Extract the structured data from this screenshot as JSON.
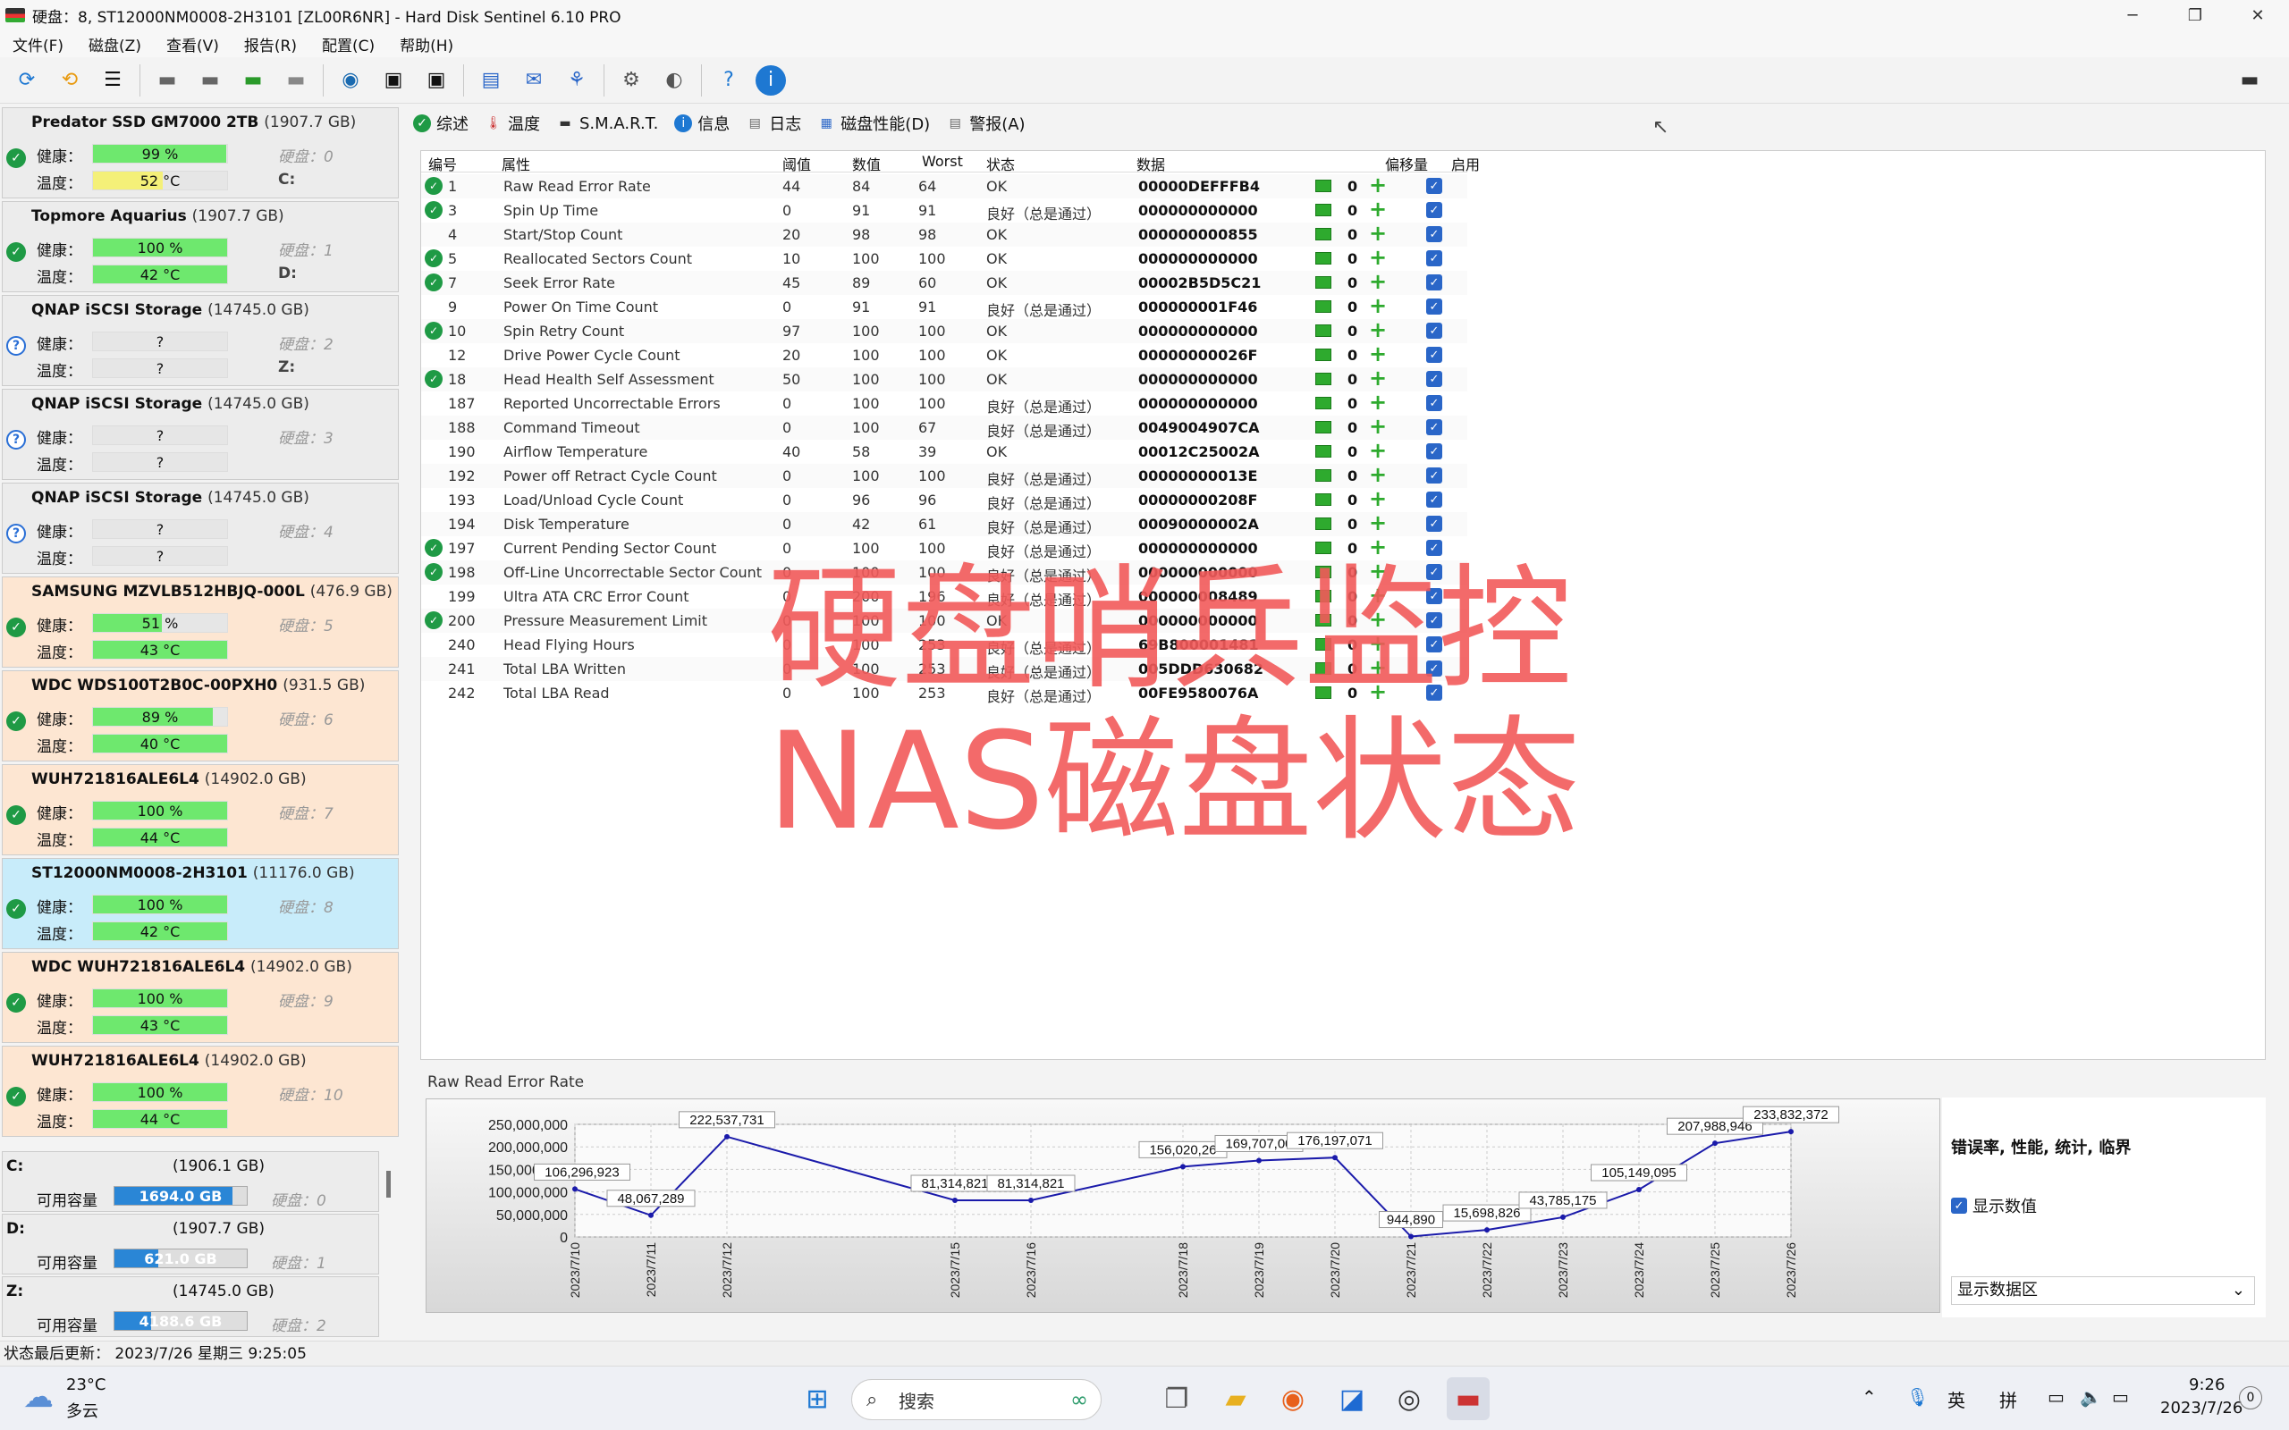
{
  "window": {
    "title": "硬盘：8, ST12000NM0008-2H3101 [ZL00R6NR]  -  Hard Disk Sentinel 6.10 PRO"
  },
  "menu": [
    "文件(F)",
    "磁盘(Z)",
    "查看(V)",
    "报告(R)",
    "配置(C)",
    "帮助(H)"
  ],
  "disks": [
    {
      "name": "Predator SSD GM7000 2TB",
      "cap": "(1907.7 GB)",
      "health": "99 %",
      "health_pct": 99,
      "temp": "52 °C",
      "temp_pct": 52,
      "temp_warn": true,
      "disk": "硬盘：0",
      "letter": "C:",
      "status": "ok",
      "style": "plain"
    },
    {
      "name": "Topmore Aquarius",
      "cap": "(1907.7 GB)",
      "health": "100 %",
      "health_pct": 100,
      "temp": "42 °C",
      "temp_pct": 100,
      "disk": "硬盘：1",
      "letter": "D:",
      "status": "ok",
      "style": "plain"
    },
    {
      "name": "QNAP     iSCSI Storage",
      "cap": "(14745.0 GB)",
      "health": "?",
      "health_pct": 0,
      "temp": "?",
      "temp_pct": 0,
      "disk": "硬盘：2",
      "letter": "Z:",
      "status": "q",
      "style": "plain"
    },
    {
      "name": "QNAP     iSCSI Storage",
      "cap": "(14745.0 GB)",
      "health": "?",
      "health_pct": 0,
      "temp": "?",
      "temp_pct": 0,
      "disk": "硬盘：3",
      "letter": "",
      "status": "q",
      "style": "plain"
    },
    {
      "name": "QNAP     iSCSI Storage",
      "cap": "(14745.0 GB)",
      "health": "?",
      "health_pct": 0,
      "temp": "?",
      "temp_pct": 0,
      "disk": "硬盘：4",
      "letter": "",
      "status": "q",
      "style": "plain"
    },
    {
      "name": "SAMSUNG MZVLB512HBJQ-000L",
      "cap": "(476.9 GB)",
      "health": "51 %",
      "health_pct": 51,
      "temp": "43 °C",
      "temp_pct": 100,
      "disk": "硬盘：5",
      "letter": "",
      "status": "ok",
      "style": "warm"
    },
    {
      "name": "WDC WDS100T2B0C-00PXH0",
      "cap": "(931.5 GB)",
      "health": "89 %",
      "health_pct": 89,
      "temp": "40 °C",
      "temp_pct": 100,
      "disk": "硬盘：6",
      "letter": "",
      "status": "ok",
      "style": "warm"
    },
    {
      "name": "WUH721816ALE6L4",
      "cap": "(14902.0 GB)",
      "health": "100 %",
      "health_pct": 100,
      "temp": "44 °C",
      "temp_pct": 100,
      "disk": "硬盘：7",
      "letter": "",
      "status": "ok",
      "style": "warm"
    },
    {
      "name": "ST12000NM0008-2H3101",
      "cap": "(11176.0 GB)",
      "health": "100 %",
      "health_pct": 100,
      "temp": "42 °C",
      "temp_pct": 100,
      "disk": "硬盘：8",
      "letter": "",
      "status": "ok",
      "style": "sel"
    },
    {
      "name": "WDC  WUH721816ALE6L4",
      "cap": "(14902.0 GB)",
      "health": "100 %",
      "health_pct": 100,
      "temp": "43 °C",
      "temp_pct": 100,
      "disk": "硬盘：9",
      "letter": "",
      "status": "ok",
      "style": "warm"
    },
    {
      "name": "WUH721816ALE6L4",
      "cap": "(14902.0 GB)",
      "health": "100 %",
      "health_pct": 100,
      "temp": "44 °C",
      "temp_pct": 100,
      "disk": "硬盘：10",
      "letter": "",
      "status": "ok",
      "style": "warm"
    }
  ],
  "labels": {
    "health": "健康：",
    "temp": "温度：",
    "free": "可用容量"
  },
  "volumes": [
    {
      "letter": "C:",
      "cap": "(1906.1 GB)",
      "free": "1694.0 GB",
      "free_pct": 89,
      "disk": "硬盘：0"
    },
    {
      "letter": "D:",
      "cap": "(1907.7 GB)",
      "free": "621.0 GB",
      "free_pct": 33,
      "disk": "硬盘：1"
    },
    {
      "letter": "Z:",
      "cap": "(14745.0 GB)",
      "free": "4188.6 GB",
      "free_pct": 28,
      "disk": "硬盘：2"
    }
  ],
  "status_bar": "状态最后更新：  2023/7/26 星期三 9:25:05",
  "tabs": [
    "综述",
    "温度",
    "S.M.A.R.T.",
    "信息",
    "日志",
    "磁盘性能(D)",
    "警报(A)"
  ],
  "table": {
    "headers": [
      "编号",
      "属性",
      "阈值",
      "数值",
      "Worst",
      "状态",
      "数据",
      "偏移量",
      "启用"
    ],
    "rows": [
      {
        "ok": true,
        "id": "1",
        "attr": "Raw Read Error Rate",
        "thr": "44",
        "val": "84",
        "worst": "64",
        "st": "OK",
        "data": "00000DEFFFB4",
        "off": "0"
      },
      {
        "ok": true,
        "id": "3",
        "attr": "Spin Up Time",
        "thr": "0",
        "val": "91",
        "worst": "91",
        "st": "良好（总是通过）",
        "data": "000000000000",
        "off": "0"
      },
      {
        "ok": false,
        "id": "4",
        "attr": "Start/Stop Count",
        "thr": "20",
        "val": "98",
        "worst": "98",
        "st": "OK",
        "data": "000000000855",
        "off": "0"
      },
      {
        "ok": true,
        "id": "5",
        "attr": "Reallocated Sectors Count",
        "thr": "10",
        "val": "100",
        "worst": "100",
        "st": "OK",
        "data": "000000000000",
        "off": "0"
      },
      {
        "ok": true,
        "id": "7",
        "attr": "Seek Error Rate",
        "thr": "45",
        "val": "89",
        "worst": "60",
        "st": "OK",
        "data": "00002B5D5C21",
        "off": "0"
      },
      {
        "ok": false,
        "id": "9",
        "attr": "Power On Time Count",
        "thr": "0",
        "val": "91",
        "worst": "91",
        "st": "良好（总是通过）",
        "data": "000000001F46",
        "off": "0"
      },
      {
        "ok": true,
        "id": "10",
        "attr": "Spin Retry Count",
        "thr": "97",
        "val": "100",
        "worst": "100",
        "st": "OK",
        "data": "000000000000",
        "off": "0"
      },
      {
        "ok": false,
        "id": "12",
        "attr": "Drive Power Cycle Count",
        "thr": "20",
        "val": "100",
        "worst": "100",
        "st": "OK",
        "data": "00000000026F",
        "off": "0"
      },
      {
        "ok": true,
        "id": "18",
        "attr": "Head Health Self Assessment",
        "thr": "50",
        "val": "100",
        "worst": "100",
        "st": "OK",
        "data": "000000000000",
        "off": "0"
      },
      {
        "ok": false,
        "id": "187",
        "attr": "Reported Uncorrectable Errors",
        "thr": "0",
        "val": "100",
        "worst": "100",
        "st": "良好（总是通过）",
        "data": "000000000000",
        "off": "0"
      },
      {
        "ok": false,
        "id": "188",
        "attr": "Command Timeout",
        "thr": "0",
        "val": "100",
        "worst": "67",
        "st": "良好（总是通过）",
        "data": "0049004907CA",
        "off": "0"
      },
      {
        "ok": false,
        "id": "190",
        "attr": "Airflow Temperature",
        "thr": "40",
        "val": "58",
        "worst": "39",
        "st": "OK",
        "data": "00012C25002A",
        "off": "0"
      },
      {
        "ok": false,
        "id": "192",
        "attr": "Power off Retract Cycle Count",
        "thr": "0",
        "val": "100",
        "worst": "100",
        "st": "良好（总是通过）",
        "data": "00000000013E",
        "off": "0"
      },
      {
        "ok": false,
        "id": "193",
        "attr": "Load/Unload Cycle Count",
        "thr": "0",
        "val": "96",
        "worst": "96",
        "st": "良好（总是通过）",
        "data": "00000000208F",
        "off": "0"
      },
      {
        "ok": false,
        "id": "194",
        "attr": "Disk Temperature",
        "thr": "0",
        "val": "42",
        "worst": "61",
        "st": "良好（总是通过）",
        "data": "00090000002A",
        "off": "0"
      },
      {
        "ok": true,
        "id": "197",
        "attr": "Current Pending Sector Count",
        "thr": "0",
        "val": "100",
        "worst": "100",
        "st": "良好（总是通过）",
        "data": "000000000000",
        "off": "0"
      },
      {
        "ok": true,
        "id": "198",
        "attr": "Off-Line Uncorrectable Sector Count",
        "thr": "0",
        "val": "100",
        "worst": "100",
        "st": "良好（总是通过）",
        "data": "000000000000",
        "off": "0"
      },
      {
        "ok": false,
        "id": "199",
        "attr": "Ultra ATA CRC Error Count",
        "thr": "0",
        "val": "200",
        "worst": "196",
        "st": "良好（总是通过）",
        "data": "000000008489",
        "off": "0"
      },
      {
        "ok": true,
        "id": "200",
        "attr": "Pressure Measurement Limit",
        "thr": "0",
        "val": "100",
        "worst": "100",
        "st": "OK",
        "data": "000000000000",
        "off": "0"
      },
      {
        "ok": false,
        "id": "240",
        "attr": "Head Flying Hours",
        "thr": "0",
        "val": "100",
        "worst": "253",
        "st": "良好（总是通过）",
        "data": "69B800001481",
        "off": "0"
      },
      {
        "ok": false,
        "id": "241",
        "attr": "Total LBA Written",
        "thr": "0",
        "val": "100",
        "worst": "253",
        "st": "良好（总是通过）",
        "data": "005DDD630682",
        "off": "0"
      },
      {
        "ok": false,
        "id": "242",
        "attr": "Total LBA Read",
        "thr": "0",
        "val": "100",
        "worst": "253",
        "st": "良好（总是通过）",
        "data": "00FE9580076A",
        "off": "0"
      }
    ]
  },
  "watermark": [
    "硬盘哨兵监控",
    "NAS磁盘状态"
  ],
  "graph_tab": "Raw Read Error Rate",
  "chart_data": {
    "type": "line",
    "x": [
      "2023/7/10",
      "2023/7/11",
      "2023/7/12",
      "2023/7/15",
      "2023/7/16",
      "2023/7/18",
      "2023/7/19",
      "2023/7/20",
      "2023/7/21",
      "2023/7/22",
      "2023/7/23",
      "2023/7/24",
      "2023/7/25",
      "2023/7/26"
    ],
    "values": [
      106296923,
      48067289,
      222537731,
      81314821,
      81314821,
      156020261,
      169707003,
      176197071,
      944890,
      15698826,
      43785175,
      105149095,
      207988946,
      233832372
    ],
    "labels": [
      "106,296,923",
      "48,067,289",
      "222,537,731",
      "81,314,821",
      "81,314,821",
      "156,020,26",
      "169,707,00",
      "176,197,071",
      "944,890",
      "15,698,826",
      "43,785,175",
      "105,149,095",
      "207,988,946",
      "233,832,372"
    ],
    "yticks": [
      "250,000,000",
      "200,000,000",
      "150,000,000",
      "100,000,000",
      "50,000,000",
      "0"
    ],
    "ylim": [
      0,
      250000000
    ],
    "color": "#1a1aaa"
  },
  "right_panel": {
    "title": "错误率, 性能, 统计, 临界",
    "checkbox": "显示数值",
    "select": "显示数据区"
  },
  "taskbar": {
    "weather_temp": "23°C",
    "weather_desc": "多云",
    "search": "搜索",
    "ime1": "英",
    "ime2": "拼",
    "time": "9:26",
    "date": "2023/7/26"
  }
}
